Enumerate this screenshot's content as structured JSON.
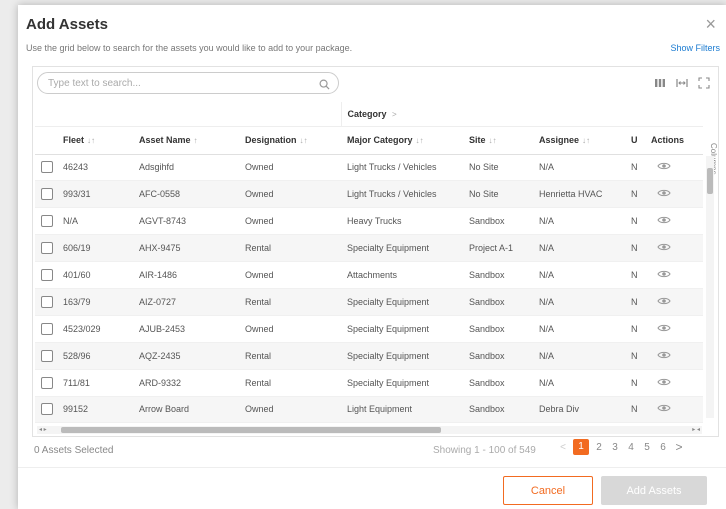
{
  "dialog": {
    "title": "Add Assets",
    "subtitle": "Use the grid below to search for the assets you would like to add to your package.",
    "show_filters": "Show Filters"
  },
  "search": {
    "placeholder": "Type text to search..."
  },
  "grid": {
    "group_header": "Category",
    "group_chevron": ">",
    "columns": [
      "Fleet",
      "Asset Name",
      "Designation",
      "Major Category",
      "Site",
      "Assignee",
      "U",
      "Actions"
    ],
    "sort_marks": [
      "↓↑",
      "↑",
      "↓↑",
      "↓↑",
      "↓↑",
      "↓↑"
    ],
    "side_panel_label": "Columns",
    "rows": [
      {
        "fleet": "46243",
        "asset_name": "Adsgihfd",
        "designation": "Owned",
        "major_category": "Light Trucks / Vehicles",
        "site": "No Site",
        "assignee": "N/A",
        "u": "N"
      },
      {
        "fleet": "993/31",
        "asset_name": "AFC-0558",
        "designation": "Owned",
        "major_category": "Light Trucks / Vehicles",
        "site": "No Site",
        "assignee": "Henrietta HVAC",
        "u": "N"
      },
      {
        "fleet": "N/A",
        "asset_name": "AGVT-8743",
        "designation": "Owned",
        "major_category": "Heavy Trucks",
        "site": "Sandbox",
        "assignee": "N/A",
        "u": "N"
      },
      {
        "fleet": "606/19",
        "asset_name": "AHX-9475",
        "designation": "Rental",
        "major_category": "Specialty Equipment",
        "site": "Project A-1",
        "assignee": "N/A",
        "u": "N"
      },
      {
        "fleet": "401/60",
        "asset_name": "AIR-1486",
        "designation": "Owned",
        "major_category": "Attachments",
        "site": "Sandbox",
        "assignee": "N/A",
        "u": "N"
      },
      {
        "fleet": "163/79",
        "asset_name": "AIZ-0727",
        "designation": "Rental",
        "major_category": "Specialty Equipment",
        "site": "Sandbox",
        "assignee": "N/A",
        "u": "N"
      },
      {
        "fleet": "4523/029",
        "asset_name": "AJUB-2453",
        "designation": "Owned",
        "major_category": "Specialty Equipment",
        "site": "Sandbox",
        "assignee": "N/A",
        "u": "N"
      },
      {
        "fleet": "528/96",
        "asset_name": "AQZ-2435",
        "designation": "Rental",
        "major_category": "Specialty Equipment",
        "site": "Sandbox",
        "assignee": "N/A",
        "u": "N"
      },
      {
        "fleet": "711/81",
        "asset_name": "ARD-9332",
        "designation": "Rental",
        "major_category": "Specialty Equipment",
        "site": "Sandbox",
        "assignee": "N/A",
        "u": "N"
      },
      {
        "fleet": "99152",
        "asset_name": "Arrow Board",
        "designation": "Owned",
        "major_category": "Light Equipment",
        "site": "Sandbox",
        "assignee": "Debra Div",
        "u": "N"
      }
    ]
  },
  "footer": {
    "selected": "0 Assets Selected",
    "showing": "Showing 1 - 100 of 549",
    "pages": [
      "1",
      "2",
      "3",
      "4",
      "5",
      "6"
    ],
    "active_page": "1",
    "prev": "<",
    "next": ">",
    "cancel": "Cancel",
    "add": "Add Assets"
  },
  "colors": {
    "accent": "#f26b21",
    "link": "#1b7bd1",
    "disabled": "#d8d8d8"
  },
  "icons": [
    "close-icon",
    "search-icon",
    "columns-icon",
    "fit-columns-icon",
    "fullscreen-icon",
    "eye-icon",
    "chevron-right-icon"
  ]
}
